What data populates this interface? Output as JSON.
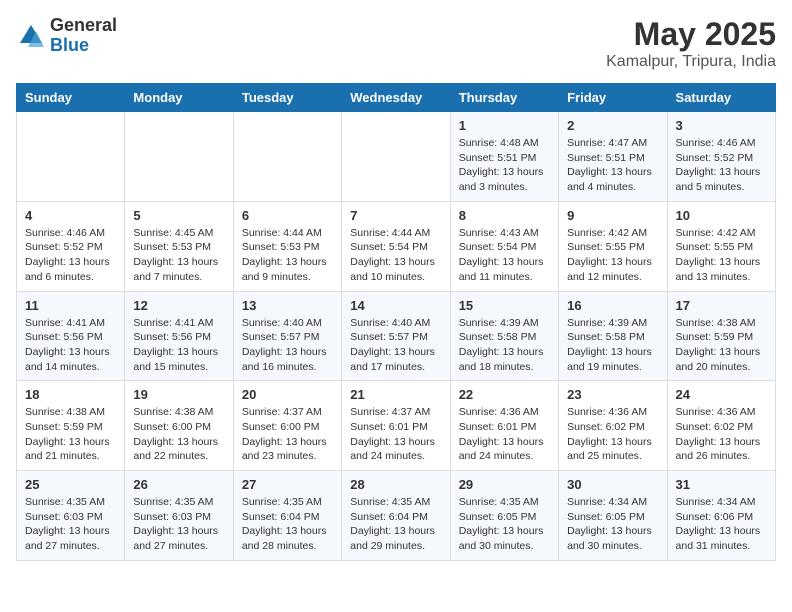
{
  "header": {
    "logo_general": "General",
    "logo_blue": "Blue",
    "month_title": "May 2025",
    "location": "Kamalpur, Tripura, India"
  },
  "weekdays": [
    "Sunday",
    "Monday",
    "Tuesday",
    "Wednesday",
    "Thursday",
    "Friday",
    "Saturday"
  ],
  "weeks": [
    [
      {
        "day": "",
        "info": ""
      },
      {
        "day": "",
        "info": ""
      },
      {
        "day": "",
        "info": ""
      },
      {
        "day": "",
        "info": ""
      },
      {
        "day": "1",
        "info": "Sunrise: 4:48 AM\nSunset: 5:51 PM\nDaylight: 13 hours\nand 3 minutes."
      },
      {
        "day": "2",
        "info": "Sunrise: 4:47 AM\nSunset: 5:51 PM\nDaylight: 13 hours\nand 4 minutes."
      },
      {
        "day": "3",
        "info": "Sunrise: 4:46 AM\nSunset: 5:52 PM\nDaylight: 13 hours\nand 5 minutes."
      }
    ],
    [
      {
        "day": "4",
        "info": "Sunrise: 4:46 AM\nSunset: 5:52 PM\nDaylight: 13 hours\nand 6 minutes."
      },
      {
        "day": "5",
        "info": "Sunrise: 4:45 AM\nSunset: 5:53 PM\nDaylight: 13 hours\nand 7 minutes."
      },
      {
        "day": "6",
        "info": "Sunrise: 4:44 AM\nSunset: 5:53 PM\nDaylight: 13 hours\nand 9 minutes."
      },
      {
        "day": "7",
        "info": "Sunrise: 4:44 AM\nSunset: 5:54 PM\nDaylight: 13 hours\nand 10 minutes."
      },
      {
        "day": "8",
        "info": "Sunrise: 4:43 AM\nSunset: 5:54 PM\nDaylight: 13 hours\nand 11 minutes."
      },
      {
        "day": "9",
        "info": "Sunrise: 4:42 AM\nSunset: 5:55 PM\nDaylight: 13 hours\nand 12 minutes."
      },
      {
        "day": "10",
        "info": "Sunrise: 4:42 AM\nSunset: 5:55 PM\nDaylight: 13 hours\nand 13 minutes."
      }
    ],
    [
      {
        "day": "11",
        "info": "Sunrise: 4:41 AM\nSunset: 5:56 PM\nDaylight: 13 hours\nand 14 minutes."
      },
      {
        "day": "12",
        "info": "Sunrise: 4:41 AM\nSunset: 5:56 PM\nDaylight: 13 hours\nand 15 minutes."
      },
      {
        "day": "13",
        "info": "Sunrise: 4:40 AM\nSunset: 5:57 PM\nDaylight: 13 hours\nand 16 minutes."
      },
      {
        "day": "14",
        "info": "Sunrise: 4:40 AM\nSunset: 5:57 PM\nDaylight: 13 hours\nand 17 minutes."
      },
      {
        "day": "15",
        "info": "Sunrise: 4:39 AM\nSunset: 5:58 PM\nDaylight: 13 hours\nand 18 minutes."
      },
      {
        "day": "16",
        "info": "Sunrise: 4:39 AM\nSunset: 5:58 PM\nDaylight: 13 hours\nand 19 minutes."
      },
      {
        "day": "17",
        "info": "Sunrise: 4:38 AM\nSunset: 5:59 PM\nDaylight: 13 hours\nand 20 minutes."
      }
    ],
    [
      {
        "day": "18",
        "info": "Sunrise: 4:38 AM\nSunset: 5:59 PM\nDaylight: 13 hours\nand 21 minutes."
      },
      {
        "day": "19",
        "info": "Sunrise: 4:38 AM\nSunset: 6:00 PM\nDaylight: 13 hours\nand 22 minutes."
      },
      {
        "day": "20",
        "info": "Sunrise: 4:37 AM\nSunset: 6:00 PM\nDaylight: 13 hours\nand 23 minutes."
      },
      {
        "day": "21",
        "info": "Sunrise: 4:37 AM\nSunset: 6:01 PM\nDaylight: 13 hours\nand 24 minutes."
      },
      {
        "day": "22",
        "info": "Sunrise: 4:36 AM\nSunset: 6:01 PM\nDaylight: 13 hours\nand 24 minutes."
      },
      {
        "day": "23",
        "info": "Sunrise: 4:36 AM\nSunset: 6:02 PM\nDaylight: 13 hours\nand 25 minutes."
      },
      {
        "day": "24",
        "info": "Sunrise: 4:36 AM\nSunset: 6:02 PM\nDaylight: 13 hours\nand 26 minutes."
      }
    ],
    [
      {
        "day": "25",
        "info": "Sunrise: 4:35 AM\nSunset: 6:03 PM\nDaylight: 13 hours\nand 27 minutes."
      },
      {
        "day": "26",
        "info": "Sunrise: 4:35 AM\nSunset: 6:03 PM\nDaylight: 13 hours\nand 27 minutes."
      },
      {
        "day": "27",
        "info": "Sunrise: 4:35 AM\nSunset: 6:04 PM\nDaylight: 13 hours\nand 28 minutes."
      },
      {
        "day": "28",
        "info": "Sunrise: 4:35 AM\nSunset: 6:04 PM\nDaylight: 13 hours\nand 29 minutes."
      },
      {
        "day": "29",
        "info": "Sunrise: 4:35 AM\nSunset: 6:05 PM\nDaylight: 13 hours\nand 30 minutes."
      },
      {
        "day": "30",
        "info": "Sunrise: 4:34 AM\nSunset: 6:05 PM\nDaylight: 13 hours\nand 30 minutes."
      },
      {
        "day": "31",
        "info": "Sunrise: 4:34 AM\nSunset: 6:06 PM\nDaylight: 13 hours\nand 31 minutes."
      }
    ]
  ]
}
